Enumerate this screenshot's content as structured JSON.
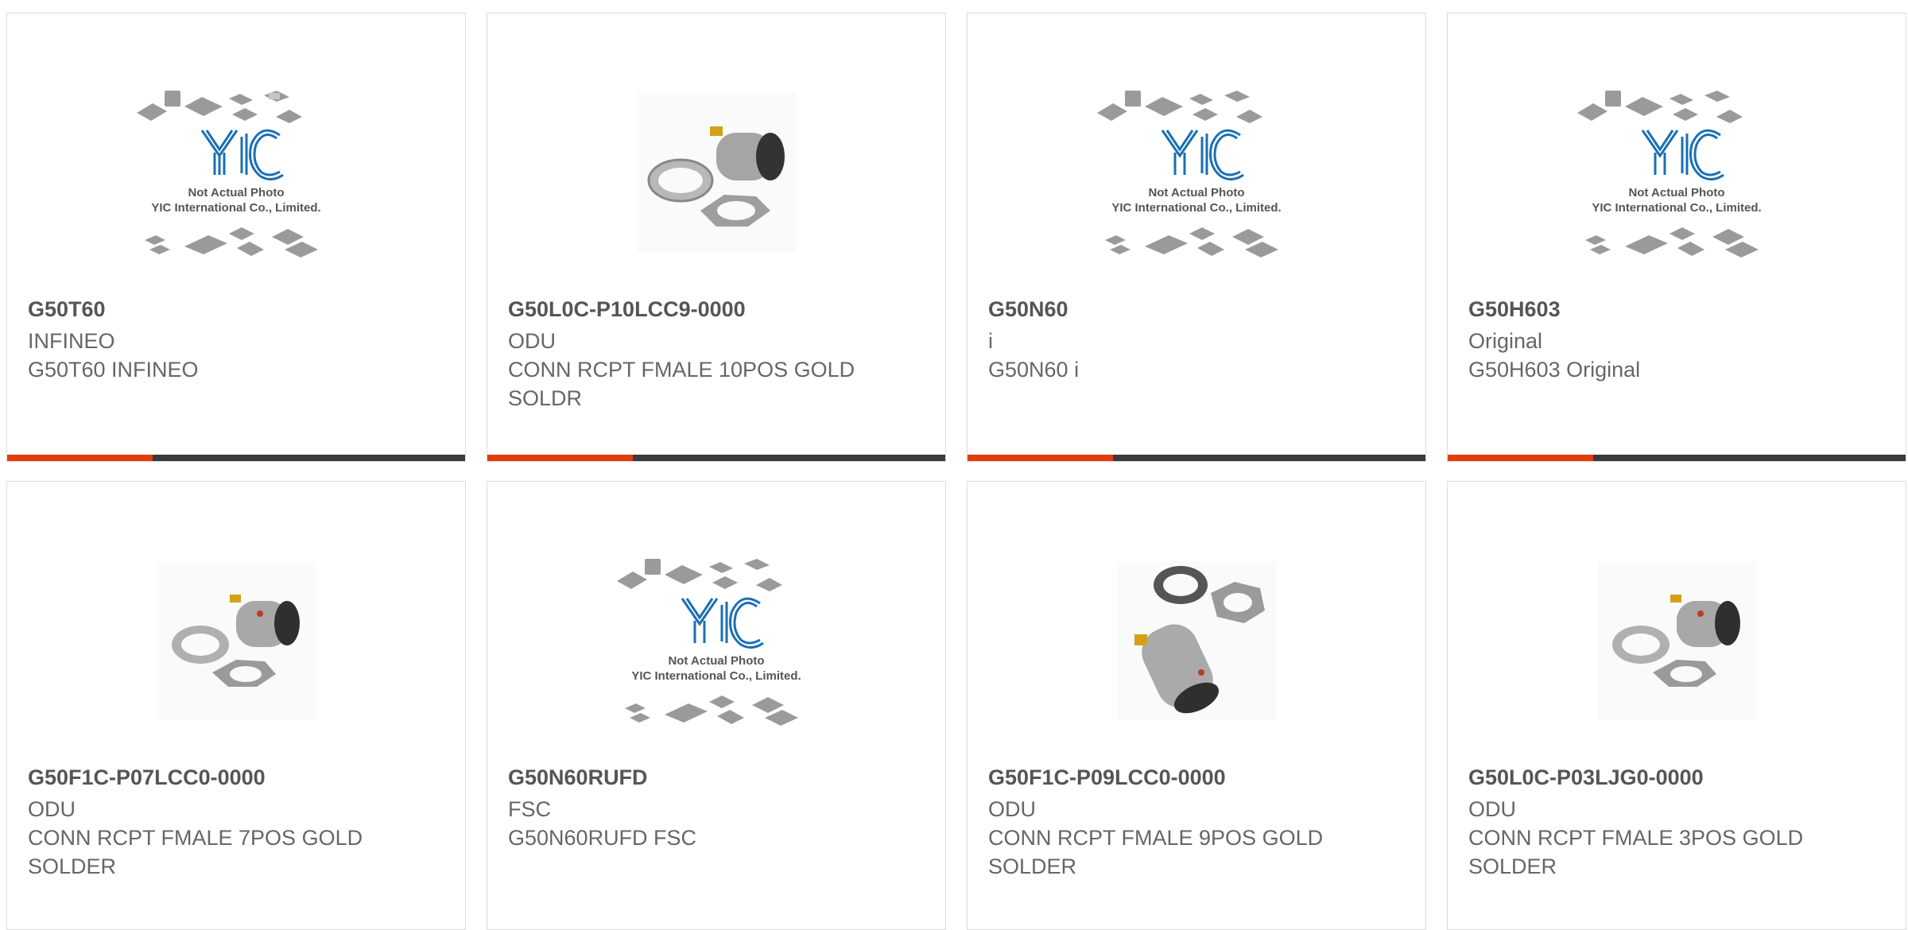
{
  "colors": {
    "accent": "#e03c0e",
    "bar": "#3a3a3a",
    "border": "#dddddd",
    "logo_blue": "#1a6fb5"
  },
  "placeholder": {
    "line1": "Not Actual Photo",
    "line2": "YIC International Co., Limited."
  },
  "products": [
    {
      "part": "G50T60",
      "mfr": "INFINEO",
      "desc": "G50T60 INFINEO",
      "image": "placeholder-logo"
    },
    {
      "part": "G50L0C-P10LCC9-0000",
      "mfr": "ODU",
      "desc": "CONN RCPT FMALE 10POS GOLD SOLDR",
      "image": "connector-photo"
    },
    {
      "part": "G50N60",
      "mfr": "i",
      "desc": "G50N60 i",
      "image": "placeholder-logo"
    },
    {
      "part": "G50H603",
      "mfr": "Original",
      "desc": "G50H603 Original",
      "image": "placeholder-logo"
    },
    {
      "part": "G50F1C-P07LCC0-0000",
      "mfr": "ODU",
      "desc": "CONN RCPT FMALE 7POS GOLD SOLDER",
      "image": "connector-photo"
    },
    {
      "part": "G50N60RUFD",
      "mfr": "FSC",
      "desc": "G50N60RUFD FSC",
      "image": "placeholder-logo"
    },
    {
      "part": "G50F1C-P09LCC0-0000",
      "mfr": "ODU",
      "desc": "CONN RCPT FMALE 9POS GOLD SOLDER",
      "image": "connector-photo-large"
    },
    {
      "part": "G50L0C-P03LJG0-0000",
      "mfr": "ODU",
      "desc": "CONN RCPT FMALE 3POS GOLD SOLDER",
      "image": "connector-photo"
    }
  ]
}
